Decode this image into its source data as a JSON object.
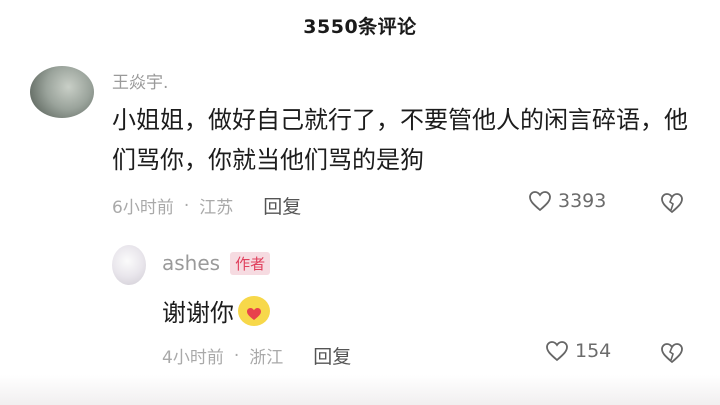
{
  "header": {
    "title": "3550条评论"
  },
  "comment": {
    "username": "王焱宇.",
    "text": "小姐姐，做好自己就行了，不要管他人的闲言碎语，他们骂你，你就当他们骂的是狗",
    "time": "6小时前",
    "separator": "·",
    "location": "江苏",
    "reply_label": "回复",
    "likes": "3393"
  },
  "reply": {
    "username": "ashes",
    "badge": "作者",
    "text": "谢谢你",
    "emoji": "face-with-heart-emoji",
    "time": "4小时前",
    "separator": "·",
    "location": "浙江",
    "reply_label": "回复",
    "likes": "154"
  },
  "colors": {
    "badge_bg": "#f6dbe1",
    "badge_text": "#e0405d",
    "meta_text": "#a9a9a9"
  }
}
